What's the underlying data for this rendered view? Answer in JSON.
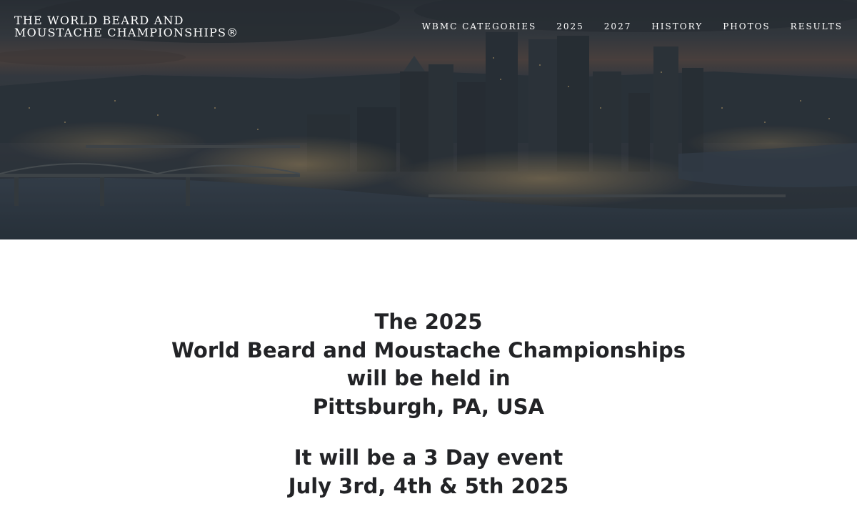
{
  "header": {
    "site_title_line1": "THE WORLD BEARD AND",
    "site_title_line2": "MOUSTACHE CHAMPIONSHIPS®"
  },
  "nav": {
    "items": [
      {
        "label": "WBMC CATEGORIES"
      },
      {
        "label": "2025"
      },
      {
        "label": "2027"
      },
      {
        "label": "HISTORY"
      },
      {
        "label": "PHOTOS"
      },
      {
        "label": "RESULTS"
      }
    ]
  },
  "hero": {
    "image": "pittsburgh-night-skyline-image"
  },
  "announcement": {
    "lines": [
      "The 2025",
      "World Beard and Moustache Championships",
      "will be held in",
      "Pittsburgh, PA, USA"
    ],
    "event_lines": [
      "It will be a 3 Day event",
      "July 3rd, 4th & 5th 2025"
    ]
  }
}
